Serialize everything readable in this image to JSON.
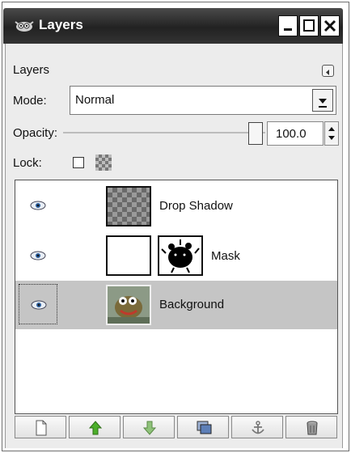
{
  "window": {
    "title": "Layers"
  },
  "panel": {
    "label": "Layers"
  },
  "mode": {
    "label": "Mode:",
    "value": "Normal"
  },
  "opacity": {
    "label": "Opacity:",
    "value": "100.0",
    "slider_fraction": 1.0
  },
  "lock": {
    "label": "Lock:",
    "pixels_checked": false
  },
  "layers": [
    {
      "name": "Drop Shadow",
      "visible": true,
      "selected": false,
      "has_mask": false
    },
    {
      "name": "Mask",
      "visible": true,
      "selected": false,
      "has_mask": true
    },
    {
      "name": "Background",
      "visible": true,
      "selected": true,
      "has_mask": false
    }
  ],
  "toolbar": {
    "buttons": [
      {
        "icon": "new-layer-icon"
      },
      {
        "icon": "raise-layer-icon"
      },
      {
        "icon": "lower-layer-icon"
      },
      {
        "icon": "duplicate-layer-icon"
      },
      {
        "icon": "anchor-layer-icon"
      },
      {
        "icon": "delete-layer-icon"
      }
    ]
  },
  "colors": {
    "titlebar": "#2c2c2c",
    "selected_row": "#c5c5c5",
    "arrow_green": "#4caf2a"
  }
}
